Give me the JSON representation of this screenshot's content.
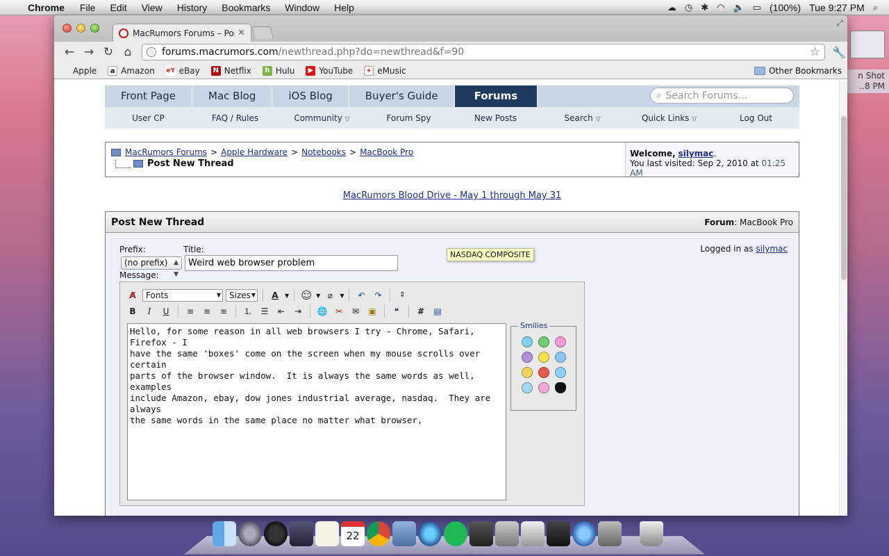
{
  "menubar": {
    "app_name": "Chrome",
    "menus": [
      "File",
      "Edit",
      "View",
      "History",
      "Bookmarks",
      "Window",
      "Help"
    ],
    "battery": "(100%)",
    "clock": "Tue 9:27 PM"
  },
  "desktop": {
    "file_label_1": "n Shot",
    "file_label_2": "..8 PM"
  },
  "browser": {
    "tab_title": "MacRumors Forums – Post N",
    "url_host": "forums.macrumors.com",
    "url_path": "/newthread.php?do=newthread&f=90",
    "bookmarks": [
      "Apple",
      "Amazon",
      "eBay",
      "Netflix",
      "Hulu",
      "YouTube",
      "eMusic"
    ],
    "other_bookmarks": "Other Bookmarks"
  },
  "site": {
    "main_tabs": [
      "Front Page",
      "Mac Blog",
      "iOS Blog",
      "Buyer's Guide",
      "Forums"
    ],
    "search_placeholder": "Search Forums...",
    "subnav": [
      "User CP",
      "FAQ / Rules",
      "Community",
      "Forum Spy",
      "New Posts",
      "Search",
      "Quick Links",
      "Log Out"
    ]
  },
  "breadcrumb": {
    "items": [
      "MacRumors Forums",
      "Apple Hardware",
      "Notebooks",
      "MacBook Pro"
    ],
    "separator": ">",
    "current": "Post New Thread",
    "welcome_label": "Welcome,",
    "username": "silymac",
    "last_visited_label": "You last visited: Sep 2, 2010 at",
    "last_visited_time": "01:25 AM"
  },
  "banner": {
    "text": "MacRumors Blood Drive - May 1 through May 31"
  },
  "form": {
    "header_title": "Post New Thread",
    "forum_label": "Forum",
    "forum_value": ": MacBook Pro",
    "prefix_label": "Prefix:",
    "prefix_value": "(no prefix)",
    "title_label": "Title:",
    "title_value": "Weird web browser problem",
    "logged_in_label": "Logged in as",
    "logged_in_user": "silymac",
    "message_label": "Message:",
    "fonts_select": "Fonts",
    "sizes_select": "Sizes",
    "message_text": "Hello, for some reason in all web browsers I try - Chrome, Safari, Firefox - I\nhave the same 'boxes' come on the screen when my mouse scrolls over certain\nparts of the browser window.  It is always the same words as well, examples\ninclude Amazon, ebay, dow jones industrial average, nasdaq.  They are always\nthe same words in the same place no matter what browser,",
    "smilies_legend": "Smilies"
  },
  "tooltip": {
    "text": "NASDAQ COMPOSITE"
  },
  "colors": {
    "nav_active": "#1e3a5f",
    "nav_bg": "#c8d6e6",
    "link": "#1a2e8a",
    "tooltip_bg": "#ffffc8"
  }
}
